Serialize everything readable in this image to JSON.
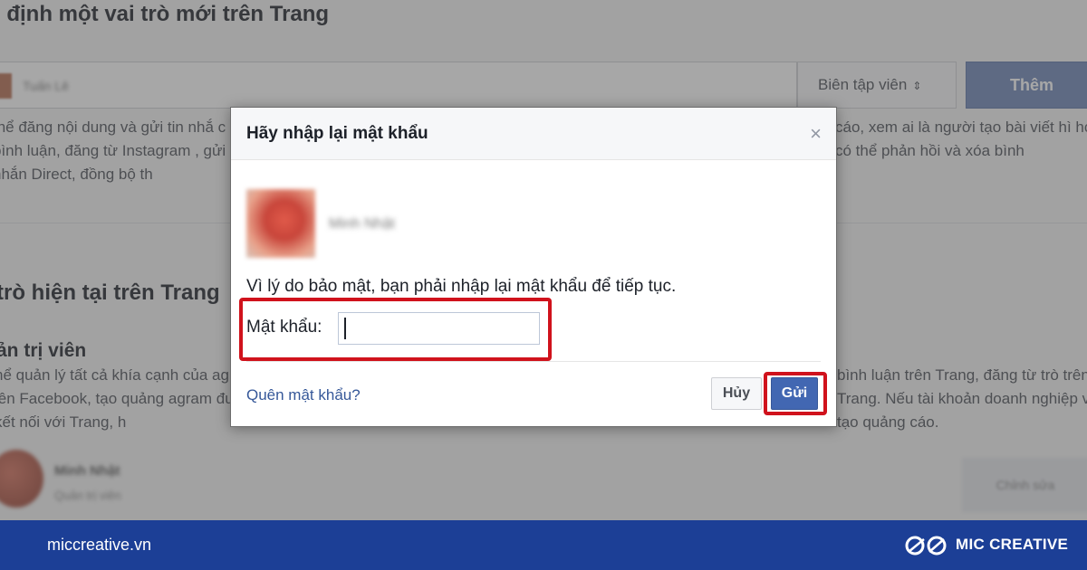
{
  "background": {
    "section_title": "i định một vai trò mới trên Trang",
    "name_input_value": "Tuấn Lê",
    "role_select": "Biên tập viên",
    "add_button": "Thêm",
    "desc_left": "thể đăng nội dung và gửi tin nhắ c bình luận, đăng từ Instagram , gửi tin nhắn Direct, đồng bộ th",
    "desc_right": "cáo, xem ai là người tạo bài viết hì họ có thể phản hồi và xóa bình",
    "current_title": "trò hiện tại trên Trang",
    "role_heading": "ản trị viên",
    "desc2_left": "hể quản lý tất cả khía cạnh của agram lên Facebook, tạo quảng agram được kết nối với Trang, h",
    "desc2_right": "bình luận trên Trang, đăng từ trò trên Trang. Nếu tài khoản doanh nghiệp và tạo quảng cáo.",
    "person_name": "Minh Nhật",
    "person_sub": "Quản trị viên",
    "edit_button": "Chỉnh sửa"
  },
  "dialog": {
    "title": "Hãy nhập lại mật khẩu",
    "close_glyph": "×",
    "user_name": "Minh Nhật",
    "message": "Vì lý do bảo mật, bạn phải nhập lại mật khẩu để tiếp tục.",
    "password_label": "Mật khẩu:",
    "password_value": "",
    "forgot_link": "Quên mật khẩu?",
    "cancel_button": "Hủy",
    "send_button": "Gửi"
  },
  "footer": {
    "site": "miccreative.vn",
    "brand": "MIC CREATIVE"
  },
  "colors": {
    "facebook_blue": "#4267b2",
    "highlight_red": "#d0121c",
    "brand_bar": "#1c3f96"
  },
  "icons": {
    "close": "close-icon",
    "logo": "mic-logo-icon"
  }
}
